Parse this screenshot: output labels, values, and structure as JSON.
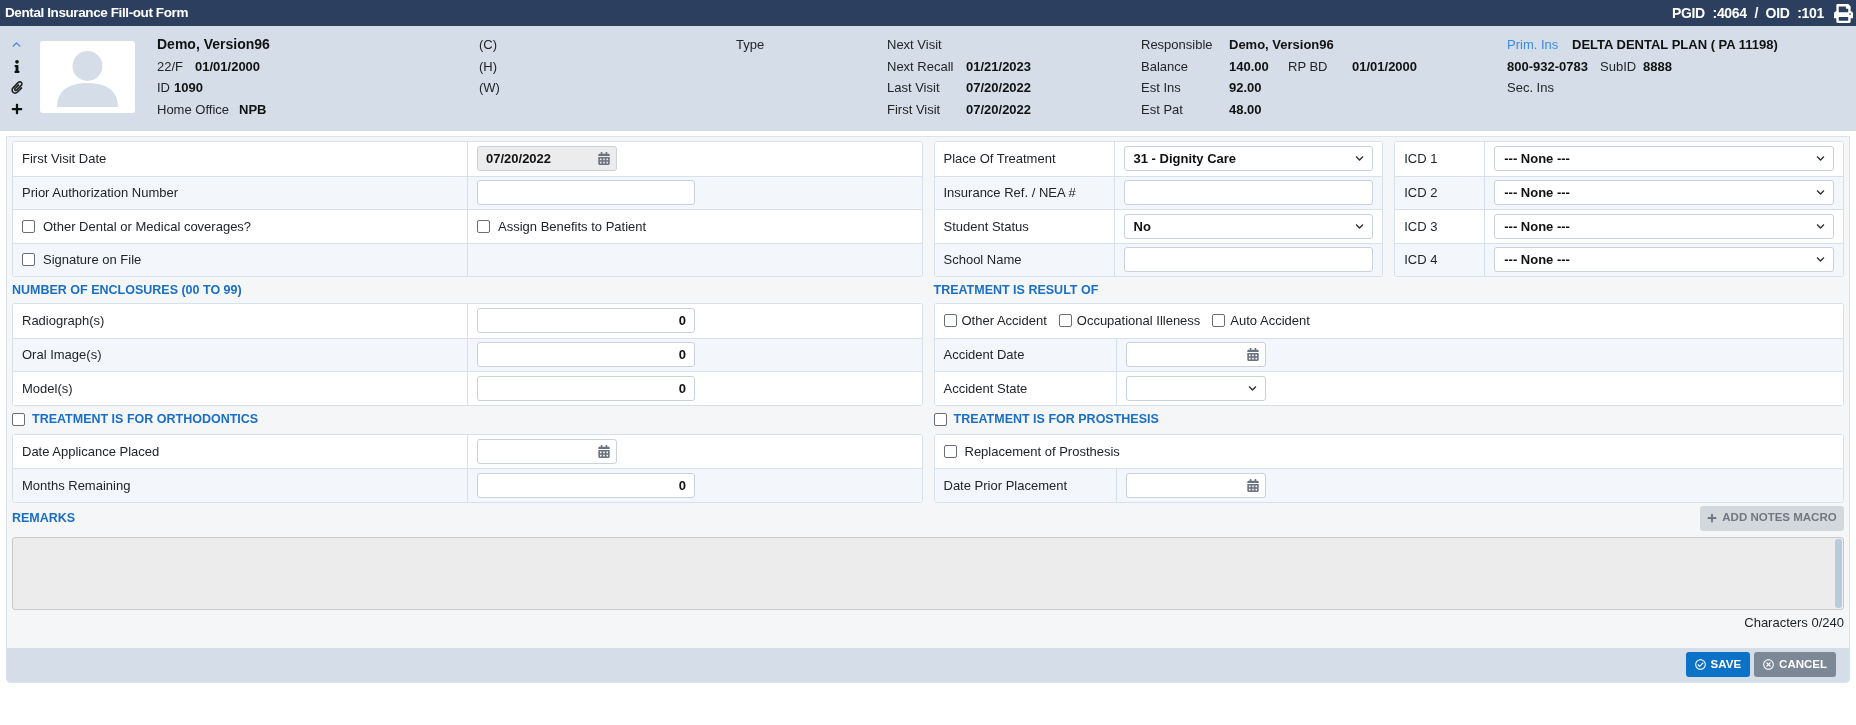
{
  "window": {
    "title": "Dental Insurance Fill-out Form",
    "ids": "PGID :4064 / OID :101"
  },
  "header": {
    "patient": {
      "name": "Demo, Version96",
      "age_sex": "22/F",
      "dob": "01/01/2000",
      "id_label": "ID",
      "id": "1090",
      "office_label": "Home Office",
      "office": "NPB"
    },
    "phones": [
      "(C)",
      "(H)",
      "(W)"
    ],
    "type_label": "Type",
    "visits": [
      {
        "label": "Next Visit"
      },
      {
        "label": "Next Recall",
        "value": "01/21/2023"
      },
      {
        "label": "Last Visit",
        "value": "07/20/2022"
      },
      {
        "label": "First Visit",
        "value": "07/20/2022"
      }
    ],
    "account": [
      {
        "label": "Responsible",
        "value": "Demo, Version96"
      },
      {
        "label": "Balance",
        "value": "140.00",
        "extra_label": "RP BD",
        "extra_value": "01/01/2000"
      },
      {
        "label": "Est Ins",
        "value": "92.00"
      },
      {
        "label": "Est Pat",
        "value": "48.00"
      }
    ],
    "insurance": {
      "primary_label": "Prim. Ins",
      "primary": "DELTA DENTAL PLAN ( PA 11198)",
      "phone": "800-932-0783",
      "subid_label": "SubID",
      "subid": "8888",
      "secondary_label": "Sec. Ins"
    }
  },
  "form": {
    "general": {
      "rows": [
        {
          "cells": [
            {
              "kind": "label",
              "text": "First Visit Date"
            },
            {
              "kind": "date",
              "value": "07/20/2022",
              "disabled": true
            }
          ]
        },
        {
          "cells": [
            {
              "kind": "label",
              "text": "Prior Authorization Number"
            },
            {
              "kind": "text"
            }
          ]
        },
        {
          "cells": [
            {
              "kind": "checkbox",
              "text": "Other Dental or Medical coverages?",
              "checked": false
            },
            {
              "kind": "checkbox",
              "text": "Assign Benefits to Patient",
              "checked": false
            }
          ]
        },
        {
          "cells": [
            {
              "kind": "checkbox",
              "text": "Signature on File",
              "checked": false
            },
            {
              "kind": "empty"
            }
          ]
        }
      ]
    },
    "treatment": {
      "rows": [
        {
          "cells": [
            {
              "kind": "label",
              "text": "Place Of Treatment"
            },
            {
              "kind": "select",
              "value": "31 - Dignity Care"
            }
          ]
        },
        {
          "cells": [
            {
              "kind": "label",
              "text": "Insurance Ref. / NEA #"
            },
            {
              "kind": "text"
            }
          ]
        },
        {
          "cells": [
            {
              "kind": "label",
              "text": "Student Status"
            },
            {
              "kind": "select",
              "value": "No"
            }
          ]
        },
        {
          "cells": [
            {
              "kind": "label",
              "text": "School Name"
            },
            {
              "kind": "text"
            }
          ]
        }
      ]
    },
    "icd": {
      "rows": [
        {
          "cells": [
            {
              "kind": "label",
              "text": "ICD 1"
            },
            {
              "kind": "select",
              "value": "--- None ---"
            }
          ]
        },
        {
          "cells": [
            {
              "kind": "label",
              "text": "ICD 2"
            },
            {
              "kind": "select",
              "value": "--- None ---"
            }
          ]
        },
        {
          "cells": [
            {
              "kind": "label",
              "text": "ICD 3"
            },
            {
              "kind": "select",
              "value": "--- None ---"
            }
          ]
        },
        {
          "cells": [
            {
              "kind": "label",
              "text": "ICD 4"
            },
            {
              "kind": "select",
              "value": "--- None ---"
            }
          ]
        }
      ]
    },
    "enclosures": {
      "title": "NUMBER OF ENCLOSURES (00 TO 99)",
      "rows": [
        {
          "cells": [
            {
              "kind": "label",
              "text": "Radiograph(s)"
            },
            {
              "kind": "number",
              "value": "0"
            }
          ]
        },
        {
          "cells": [
            {
              "kind": "label",
              "text": "Oral Image(s)"
            },
            {
              "kind": "number",
              "value": "0"
            }
          ]
        },
        {
          "cells": [
            {
              "kind": "label",
              "text": "Model(s)"
            },
            {
              "kind": "number",
              "value": "0"
            }
          ]
        }
      ]
    },
    "result_of": {
      "title": "TREATMENT IS RESULT OF",
      "rows": [
        {
          "cells": [
            {
              "kind": "checkboxes",
              "items": [
                {
                  "text": "Other Accident",
                  "checked": false
                },
                {
                  "text": "Occupational Illeness",
                  "checked": false
                },
                {
                  "text": "Auto Accident",
                  "checked": false
                }
              ]
            }
          ]
        },
        {
          "cells": [
            {
              "kind": "label",
              "text": "Accident Date"
            },
            {
              "kind": "date",
              "disabled": false
            }
          ]
        },
        {
          "cells": [
            {
              "kind": "label",
              "text": "Accident State"
            },
            {
              "kind": "select"
            }
          ]
        }
      ]
    },
    "orthodontics": {
      "title": "TREATMENT IS FOR ORTHODONTICS",
      "checked": false,
      "rows": [
        {
          "cells": [
            {
              "kind": "label",
              "text": "Date Applicance Placed"
            },
            {
              "kind": "date",
              "disabled": false
            }
          ]
        },
        {
          "cells": [
            {
              "kind": "label",
              "text": "Months Remaining"
            },
            {
              "kind": "number",
              "value": "0"
            }
          ]
        }
      ]
    },
    "prosthesis": {
      "title": "TREATMENT IS FOR PROSTHESIS",
      "checked": false,
      "rows": [
        {
          "cells": [
            {
              "kind": "checkbox",
              "text": "Replacement of Prosthesis",
              "checked": false
            }
          ]
        },
        {
          "cells": [
            {
              "kind": "label",
              "text": "Date Prior Placement"
            },
            {
              "kind": "date",
              "disabled": false
            }
          ]
        }
      ]
    },
    "remarks": {
      "title": "REMARKS",
      "macro_button": {
        "label": "ADD NOTES MACRO",
        "disabled": true
      },
      "counter": "Characters 0/240"
    }
  },
  "footer": {
    "buttons": [
      {
        "kind": "primary",
        "label": "SAVE"
      },
      {
        "kind": "secondary",
        "label": "CANCEL"
      }
    ]
  }
}
